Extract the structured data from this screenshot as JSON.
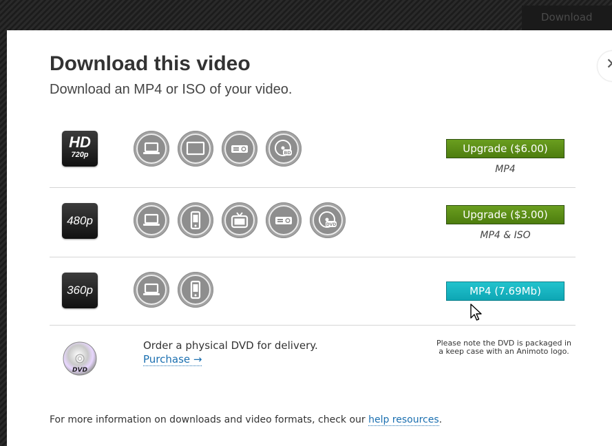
{
  "background": {
    "top_button_label": "Download"
  },
  "modal": {
    "close_label": "✕",
    "title": "Download this video",
    "subtitle": "Download an MP4 or ISO of your video.",
    "rows": [
      {
        "quality_main": "HD",
        "quality_sub": "720p",
        "devices": [
          "laptop-icon",
          "monitor-icon",
          "projector-icon",
          "bluray-disc-icon"
        ],
        "button_label": "Upgrade ($6.00)",
        "button_color": "#5a8c16",
        "formats": "MP4"
      },
      {
        "quality_main": "480p",
        "devices": [
          "laptop-icon",
          "phone-icon",
          "tv-icon",
          "projector-icon",
          "dvd-disc-icon"
        ],
        "button_label": "Upgrade ($3.00)",
        "button_color": "#5a8c16",
        "formats": "MP4 & ISO"
      },
      {
        "quality_main": "360p",
        "devices": [
          "laptop-icon",
          "phone-icon"
        ],
        "button_label": "MP4 (7.69Mb)",
        "button_color": "#17b4c0"
      }
    ],
    "dvd": {
      "icon": "dvd-disc-icon",
      "text": "Order a physical DVD for delivery.",
      "purchase_label": "Purchase →",
      "note": "Please note the DVD is packaged in a keep case with an Animoto logo."
    },
    "footer": {
      "text": "For more information on downloads and video formats, check our ",
      "link_label": "help resources",
      "suffix": "."
    }
  }
}
